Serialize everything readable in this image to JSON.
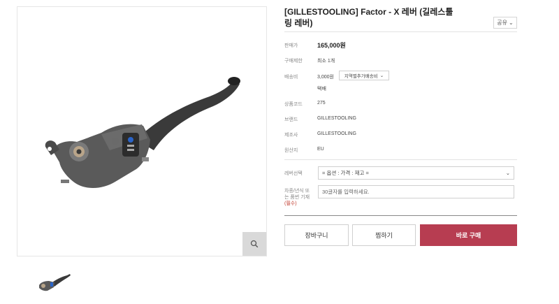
{
  "product": {
    "title": "[GILLESTOOLING] Factor - X 레버 (길레스툴링 레버)",
    "share_label": "공유",
    "main_image_icon": "brake-lever-image",
    "thumbnail_icon": "brake-lever-thumbnail"
  },
  "details": {
    "price_label": "판매가",
    "price_value": "165,000원",
    "limit_label": "구매제한",
    "limit_value": "최소 1개",
    "shipping_label": "배송비",
    "shipping_value": "3,000원",
    "shipping_select": "지역별추가배송비",
    "shipping_method": "택배",
    "code_label": "상품코드",
    "code_value": "275",
    "brand_label": "브랜드",
    "brand_value": "GILLESTOOLING",
    "maker_label": "제조사",
    "maker_value": "GILLESTOOLING",
    "origin_label": "원산지",
    "origin_value": "EU"
  },
  "options": {
    "lever_label": "레버선택",
    "lever_select": "= 옵션 : 가격 : 재고 =",
    "vehicle_label_1": "차종/년식 또",
    "vehicle_label_2": "는 품번 기재",
    "vehicle_required": "(필수)",
    "vehicle_placeholder": "30글자를 입력하세요."
  },
  "actions": {
    "cart": "장바구니",
    "wishlist": "찜하기",
    "buy": "바로 구매"
  },
  "colors": {
    "buy_button": "#b73d51",
    "zoom_button": "#d9d9d9"
  }
}
